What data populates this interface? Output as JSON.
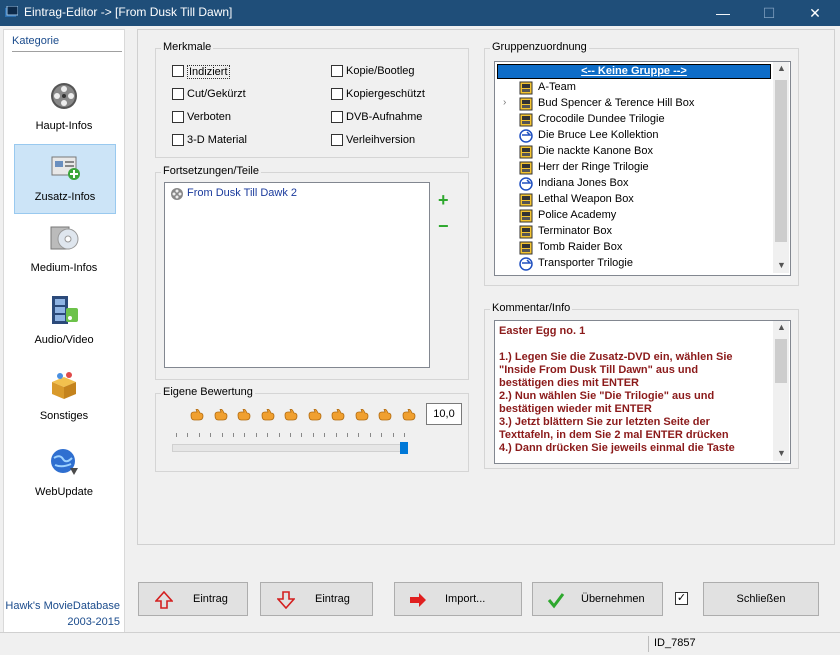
{
  "window": {
    "title": "Eintrag-Editor -> [From Dusk Till Dawn]",
    "minimize": "—",
    "maximize": "☐",
    "close": "✕"
  },
  "sidebar": {
    "heading": "Kategorie",
    "items": [
      {
        "label": "Haupt-Infos",
        "icon": "film-reel-icon"
      },
      {
        "label": "Zusatz-Infos",
        "icon": "info-card-add-icon"
      },
      {
        "label": "Medium-Infos",
        "icon": "disc-icon"
      },
      {
        "label": "Audio/Video",
        "icon": "filmstrip-music-icon"
      },
      {
        "label": "Sonstiges",
        "icon": "box-icon"
      },
      {
        "label": "WebUpdate",
        "icon": "globe-update-icon"
      }
    ],
    "brand_line1": "Hawk's MovieDatabase",
    "brand_line2": "2003-2015"
  },
  "merkmale": {
    "title": "Merkmale",
    "checkboxes": [
      {
        "label": "Indiziert",
        "checked": false
      },
      {
        "label": "Cut/Gekürzt",
        "checked": false
      },
      {
        "label": "Verboten",
        "checked": false
      },
      {
        "label": "3-D Material",
        "checked": false
      },
      {
        "label": "Kopie/Bootleg",
        "checked": false
      },
      {
        "label": "Kopiergeschützt",
        "checked": false
      },
      {
        "label": "DVB-Aufnahme",
        "checked": false
      },
      {
        "label": "Verleihversion",
        "checked": false
      }
    ]
  },
  "fortsetzungen": {
    "title": "Fortsetzungen/Teile",
    "items": [
      "From Dusk Till Dawk 2"
    ],
    "add": "+",
    "remove": "−"
  },
  "bewertung": {
    "title": "Eigene Bewertung",
    "value": "10,0",
    "stars": 10,
    "level": 1.0
  },
  "gruppen": {
    "title": "Gruppenzuordnung",
    "items": [
      {
        "label": "<-- Keine Gruppe -->",
        "selected": true,
        "icon": ""
      },
      {
        "label": "A-Team",
        "icon": "film-box-icon"
      },
      {
        "label": "Bud Spencer & Terence Hill Box",
        "icon": "film-box-icon"
      },
      {
        "label": "Crocodile Dundee Trilogie",
        "icon": "film-box-icon"
      },
      {
        "label": "Die Bruce Lee Kollektion",
        "icon": "disc-arrow-icon"
      },
      {
        "label": "Die nackte Kanone Box",
        "icon": "film-box-icon"
      },
      {
        "label": "Herr der Ringe Trilogie",
        "icon": "film-box-icon"
      },
      {
        "label": "Indiana Jones Box",
        "icon": "disc-arrow-icon"
      },
      {
        "label": "Lethal Weapon Box",
        "icon": "film-box-icon"
      },
      {
        "label": "Police Academy",
        "icon": "film-box-icon"
      },
      {
        "label": "Terminator Box",
        "icon": "film-box-icon"
      },
      {
        "label": "Tomb Raider Box",
        "icon": "film-box-icon"
      },
      {
        "label": "Transporter Trilogie",
        "icon": "disc-arrow-icon"
      }
    ]
  },
  "kommentar": {
    "title": "Kommentar/Info",
    "lines": [
      "Easter Egg no. 1",
      "",
      "1.) Legen Sie die Zusatz-DVD ein, wählen Sie",
      "\"Inside From Dusk Till Dawn\" aus und",
      "bestätigen dies mit ENTER",
      "2.) Nun wählen Sie \"Die Trilogie\" aus und",
      "bestätigen wieder mit ENTER",
      "3.) Jetzt blättern Sie zur letzten Seite der",
      "Texttafeln, in dem Sie 2 mal ENTER drücken",
      "4.) Dann drücken Sie jeweils einmal die Taste"
    ]
  },
  "buttons": {
    "eintrag_up": "Eintrag",
    "eintrag_down": "Eintrag",
    "import": "Import...",
    "uebernehmen": "Übernehmen",
    "schliessen": "Schließen",
    "close_checkbox_checked": true
  },
  "status": {
    "id": "ID_7857"
  },
  "colors": {
    "titlebar": "#1f4e79",
    "accent_blue": "#1a4b8c",
    "comment_text": "#8b1a1a",
    "selection": "#cce4f7"
  }
}
